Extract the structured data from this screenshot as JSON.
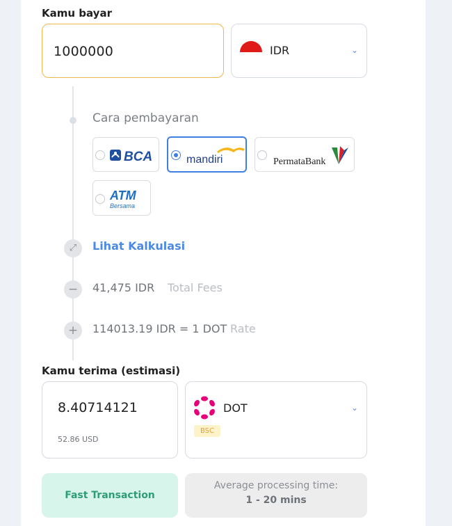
{
  "send": {
    "label": "Kamu bayar",
    "amount": "1000000",
    "currency": "IDR"
  },
  "payment": {
    "label": "Cara pembayaran",
    "methods": [
      {
        "name": "BCA",
        "selected": false
      },
      {
        "name": "mandiri",
        "selected": true
      },
      {
        "name": "PermataBank",
        "selected": false
      },
      {
        "name": "ATM Bersama",
        "selected": false
      }
    ]
  },
  "calc": {
    "link_label": "Lihat Kalkulasi",
    "fees_value": "41,475 IDR",
    "fees_label": "Total Fees",
    "rate_value": "114013.19 IDR = 1 DOT",
    "rate_label": "Rate"
  },
  "receive": {
    "label": "Kamu terima (estimasi)",
    "amount": "8.40714121",
    "usd": "52.86 USD",
    "currency": "DOT",
    "network": "BSC"
  },
  "footer": {
    "fast_label": "Fast Transaction",
    "avg_line1": "Average processing time:",
    "avg_line2": "1 - 20 mins"
  },
  "colors": {
    "accent_blue": "#3f7fe0",
    "amount_border": "#f3b64a",
    "fast_bg": "#d8f5ec",
    "dot_brand": "#e6007a"
  }
}
